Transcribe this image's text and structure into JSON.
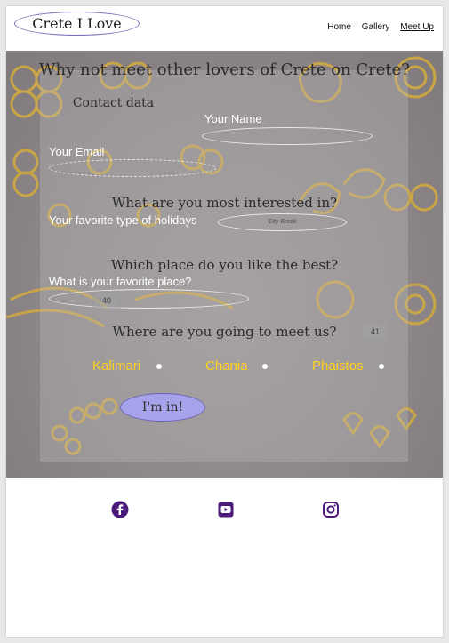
{
  "header": {
    "logo": "Crete I Love",
    "nav": [
      {
        "label": "Home",
        "active": false
      },
      {
        "label": "Gallery",
        "active": false
      },
      {
        "label": "Meet Up",
        "active": true
      }
    ]
  },
  "form": {
    "title": "Why not meet other lovers of Crete on Crete?",
    "contact_heading": "Contact data",
    "name_label": "Your Name",
    "email_label": "Your Email",
    "interest_heading": "What are you most interested in?",
    "holiday_label": "Your favorite type of holidays",
    "holiday_selected": "City Break",
    "place_heading": "Which place do you like the best?",
    "place_label": "What is your favorite place?",
    "spin_a": "40",
    "spin_b": "41",
    "meet_heading": "Where are you going to meet us?",
    "meet_options": [
      "Kalimari",
      "Chania",
      "Phaistos"
    ],
    "submit_label": "I'm in!"
  },
  "colors": {
    "accent": "#a7a3eb",
    "radio_label": "#ffd21c",
    "social_icon": "#4b1a7a"
  },
  "footer": {
    "icons": [
      "facebook-icon",
      "youtube-icon",
      "instagram-icon"
    ]
  }
}
